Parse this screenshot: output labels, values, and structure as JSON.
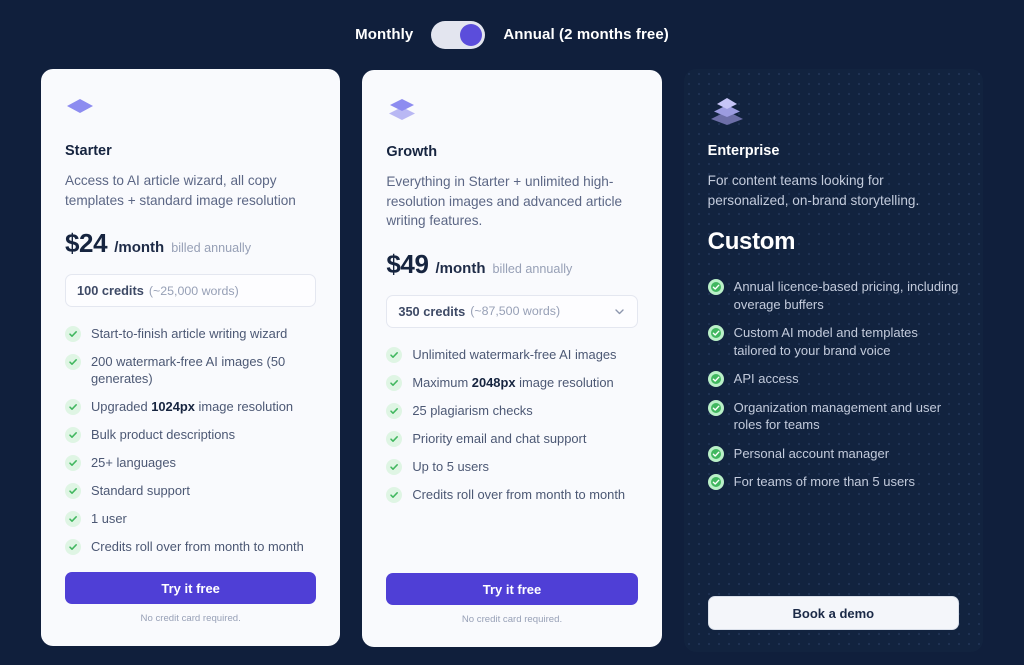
{
  "billing": {
    "monthly_label": "Monthly",
    "annual_label": "Annual (2 months free)",
    "selected": "annual",
    "toggle_icon": "toggle-switch-on"
  },
  "colors": {
    "page_background": "#101f3c",
    "card_light_background": "#f9fafd",
    "card_dark_background": "#12233f",
    "accent_purple": "#4f3fd6",
    "toggle_knob": "#5b4ddb",
    "check_green": "#41b75f",
    "icon_periwinkle": "#8d8cf0"
  },
  "plans": [
    {
      "id": "starter",
      "icon": "single-layer-diamond-icon",
      "name": "Starter",
      "description": "Access to AI article wizard, all copy templates + standard image resolution",
      "price_amount": "$24",
      "price_period": "/month",
      "price_note": "billed annually",
      "credits_value": "100 credits",
      "credits_sub": "(~25,000 words)",
      "has_dropdown": false,
      "features": [
        {
          "text": "Start-to-finish article writing wizard"
        },
        {
          "text": "200 watermark-free AI images (50 generates)"
        },
        {
          "pre": "Upgraded ",
          "bold": "1024px",
          "post": " image resolution"
        },
        {
          "text": "Bulk product descriptions"
        },
        {
          "text": "25+ languages"
        },
        {
          "text": "Standard support"
        },
        {
          "text": "1 user"
        },
        {
          "text": "Credits roll over from month to month"
        }
      ],
      "cta_label": "Try it free",
      "cta_note": "No credit card required."
    },
    {
      "id": "growth",
      "icon": "double-layer-diamond-icon",
      "name": "Growth",
      "description": "Everything in Starter + unlimited high-resolution images and advanced article writing features.",
      "price_amount": "$49",
      "price_period": "/month",
      "price_note": "billed annually",
      "credits_value": "350 credits",
      "credits_sub": "(~87,500 words)",
      "has_dropdown": true,
      "features": [
        {
          "text": "Unlimited watermark-free AI images"
        },
        {
          "pre": "Maximum ",
          "bold": "2048px",
          "post": " image resolution"
        },
        {
          "text": "25 plagiarism checks"
        },
        {
          "text": "Priority email and chat support"
        },
        {
          "text": "Up to 5 users"
        },
        {
          "text": "Credits roll over from month to month"
        }
      ],
      "cta_label": "Try it free",
      "cta_note": "No credit card required."
    },
    {
      "id": "enterprise",
      "icon": "triple-layer-stack-icon",
      "name": "Enterprise",
      "description": "For content teams looking for personalized, on-brand storytelling.",
      "price_custom": "Custom",
      "features": [
        {
          "text": "Annual licence-based pricing, including overage buffers"
        },
        {
          "text": "Custom AI model and templates tailored to your brand voice"
        },
        {
          "text": "API access"
        },
        {
          "text": "Organization management and user roles for teams"
        },
        {
          "text": "Personal account manager"
        },
        {
          "text": "For teams of more than 5 users"
        }
      ],
      "cta_label": "Book a demo"
    }
  ]
}
